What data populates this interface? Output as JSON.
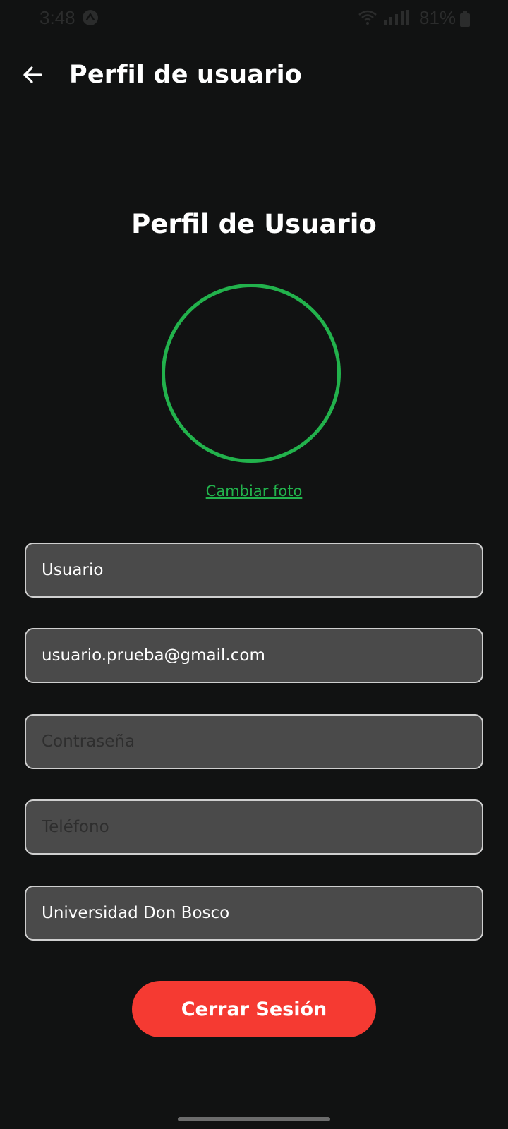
{
  "status_bar": {
    "time": "3:48",
    "battery": "81%",
    "app_icon": "android-robot-icon",
    "wifi_icon": "wifi-icon",
    "signal_icon": "cell-signal-icon",
    "battery_icon": "battery-icon"
  },
  "app_bar": {
    "title": "Perfil de usuario",
    "back_icon": "arrow-left-icon"
  },
  "profile": {
    "heading": "Perfil de Usuario",
    "change_photo_label": "Cambiar foto"
  },
  "form": {
    "username": {
      "value": "Usuario",
      "placeholder": ""
    },
    "email": {
      "value": "usuario.prueba@gmail.com",
      "placeholder": ""
    },
    "password": {
      "value": "",
      "placeholder": "Contraseña"
    },
    "phone": {
      "value": "",
      "placeholder": "Teléfono"
    },
    "institution": {
      "value": "Universidad Don Bosco",
      "placeholder": ""
    }
  },
  "actions": {
    "logout_label": "Cerrar Sesión"
  },
  "colors": {
    "background": "#111212",
    "accent_green": "#22b24c",
    "danger_red": "#f53a32",
    "field_bg": "#4a4a4a",
    "field_border": "#cfcfcf"
  }
}
